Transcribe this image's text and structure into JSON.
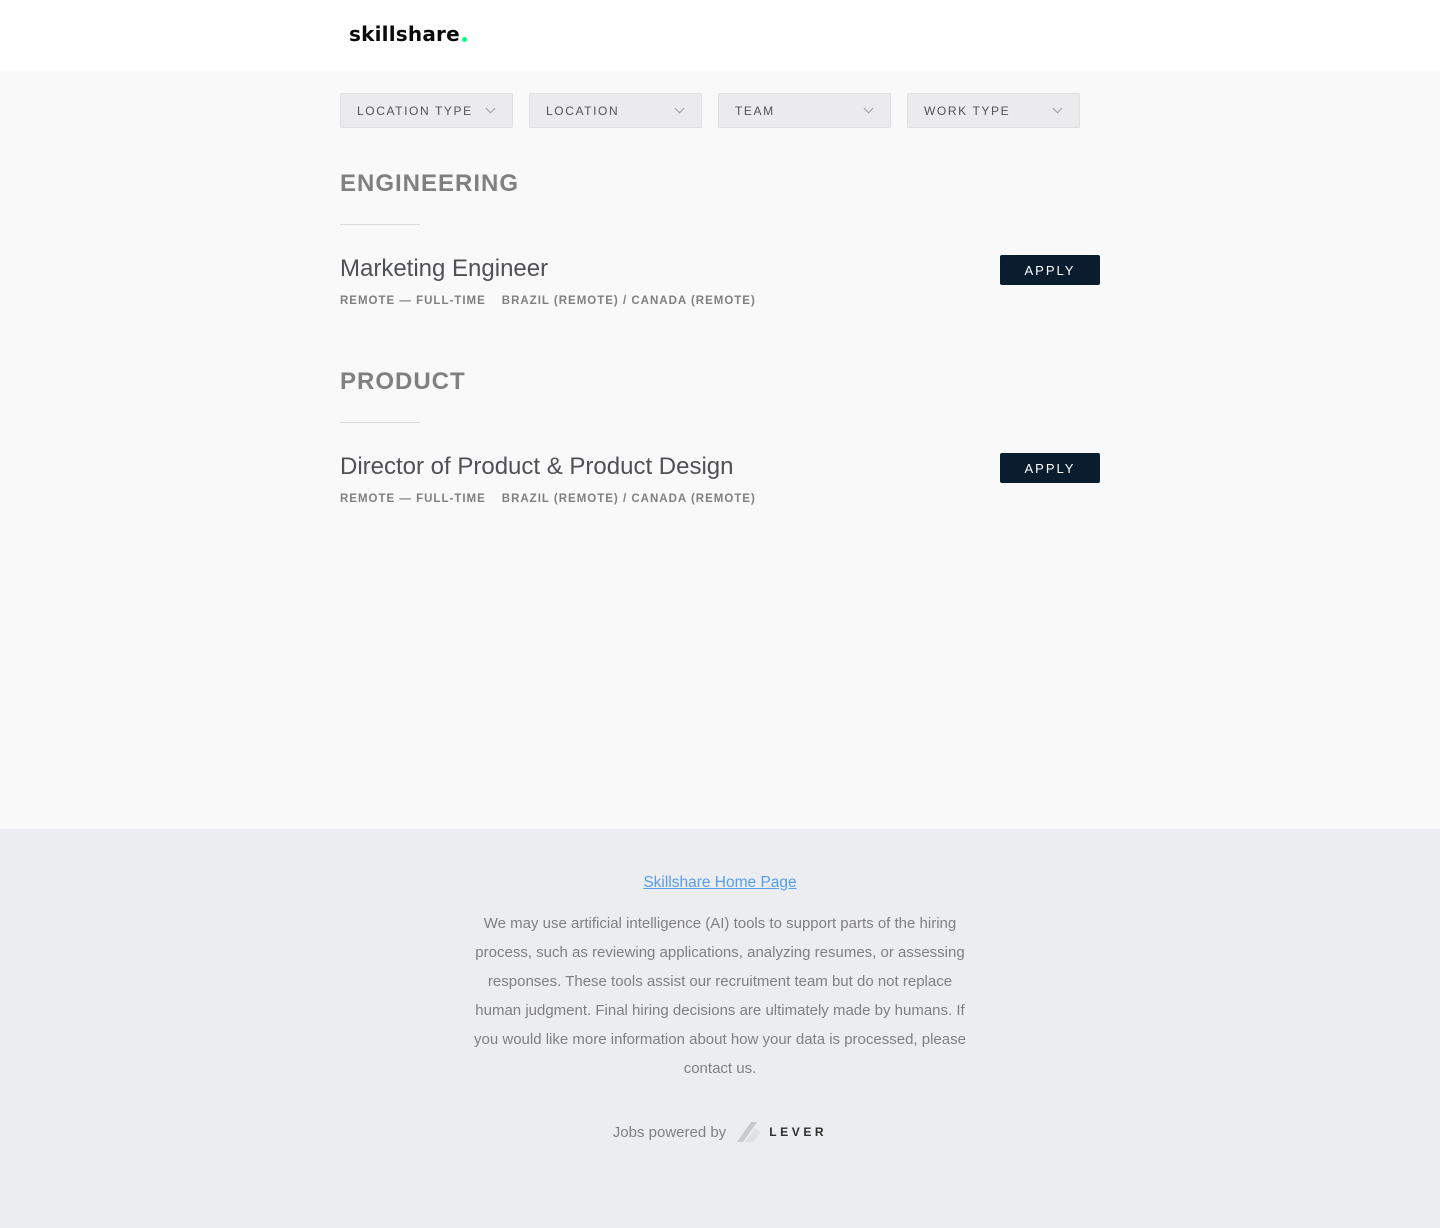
{
  "header": {
    "logo_text": "skillshare",
    "logo_dot_color": "#00ff84"
  },
  "filters": [
    {
      "label": "LOCATION TYPE"
    },
    {
      "label": "LOCATION"
    },
    {
      "label": "TEAM"
    },
    {
      "label": "WORK TYPE"
    }
  ],
  "groups": [
    {
      "title": "ENGINEERING",
      "postings": [
        {
          "title": "Marketing Engineer",
          "work_type": "REMOTE — FULL-TIME",
          "location": "BRAZIL (REMOTE) / CANADA (REMOTE)",
          "apply_label": "APPLY"
        }
      ]
    },
    {
      "title": "PRODUCT",
      "postings": [
        {
          "title": "Director of Product & Product Design",
          "work_type": "REMOTE — FULL-TIME",
          "location": "BRAZIL (REMOTE) / CANADA (REMOTE)",
          "apply_label": "APPLY"
        }
      ]
    }
  ],
  "footer": {
    "home_link": "Skillshare Home Page",
    "ai_notice": "We may use artificial intelligence (AI) tools to support parts of the hiring process, such as reviewing applications, analyzing resumes, or assessing responses. These tools assist our recruitment team but do not replace human judgment. Final hiring decisions are ultimately made by humans. If you would like more information about how your data is processed, please contact us.",
    "powered_by": "Jobs powered by",
    "lever_word": "LEVER"
  },
  "colors": {
    "apply_bg": "#0a1d2e",
    "link": "#579eee"
  }
}
